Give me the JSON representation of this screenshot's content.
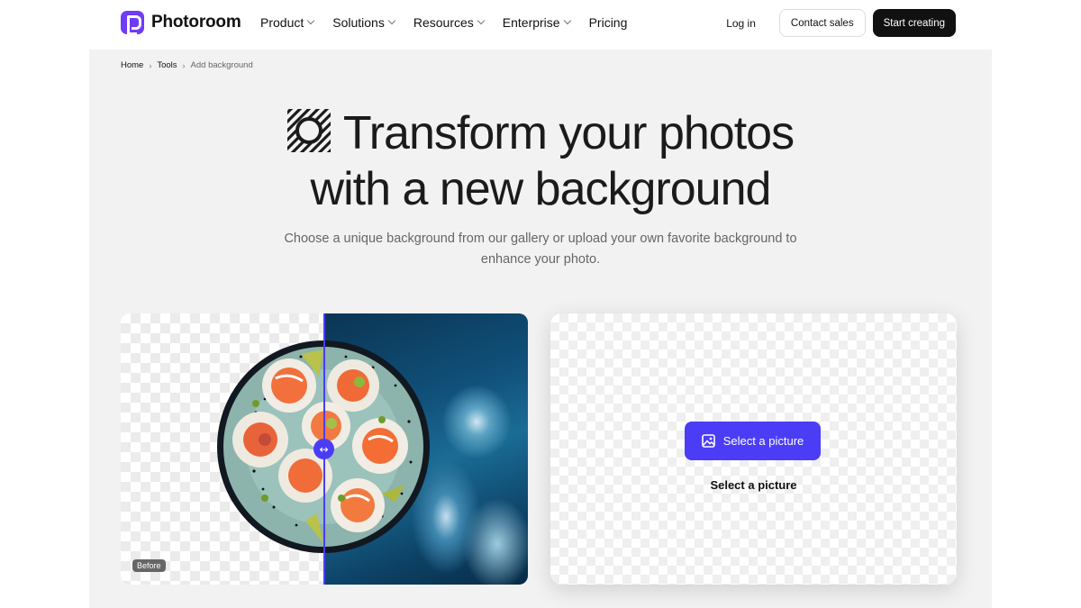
{
  "brand": {
    "name": "Photoroom",
    "accent": "#6f3bf5",
    "primary": "#4b3df5"
  },
  "nav": {
    "items": [
      {
        "label": "Product",
        "has_dropdown": true
      },
      {
        "label": "Solutions",
        "has_dropdown": true
      },
      {
        "label": "Resources",
        "has_dropdown": true
      },
      {
        "label": "Enterprise",
        "has_dropdown": true
      },
      {
        "label": "Pricing",
        "has_dropdown": false
      }
    ],
    "login": "Log in",
    "contact": "Contact sales",
    "cta": "Start creating"
  },
  "breadcrumb": [
    "Home",
    "Tools",
    "Add background"
  ],
  "hero": {
    "title_line1": "Transform your photos",
    "title_line2": "with a new background",
    "subtitle_line1": "Choose a unique background from our gallery or upload your own favorite background to",
    "subtitle_line2": "enhance your photo.",
    "icon": "hatched-sun-icon"
  },
  "comparison": {
    "before_label": "Before",
    "handle_icon": "swap-arrows-icon",
    "handle_glyph": "↔"
  },
  "upload": {
    "button_label": "Select a picture",
    "caption": "Select a picture",
    "button_icon": "image-icon"
  }
}
